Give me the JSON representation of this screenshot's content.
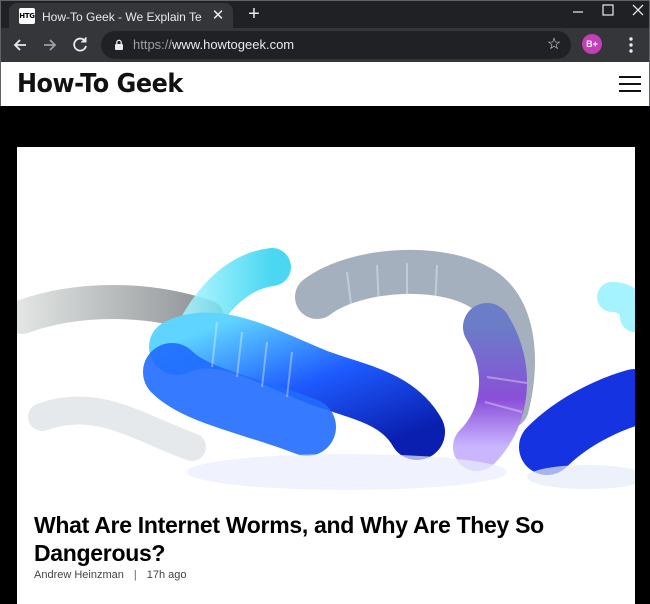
{
  "browser": {
    "tab": {
      "favicon_text": "HTG",
      "title": "How-To Geek - We Explain Techn",
      "close_glyph": "✕"
    },
    "new_tab_glyph": "+",
    "window_controls": {
      "minimize": "—",
      "maximize": "☐",
      "close": "✕"
    },
    "address_bar": {
      "scheme": "https://",
      "host": "www.howtogeek.com"
    },
    "bookmark_glyph": "☆",
    "profile_initials": "B+"
  },
  "site": {
    "logo_text": "How-To Geek"
  },
  "article": {
    "headline": "What Are Internet Worms, and Why Are They So Dangerous?",
    "author": "Andrew Heinzman",
    "separator": "|",
    "time_ago": "17h ago"
  },
  "colors": {
    "chrome_bg": "#202124",
    "toolbar_bg": "#35363a",
    "profile_accent": "#c23fb8",
    "page_bg": "#000000"
  },
  "icons": {
    "back": "arrow-left-icon",
    "forward": "arrow-right-icon",
    "reload": "reload-icon",
    "lock": "lock-icon",
    "star": "star-icon",
    "menu": "vertical-dots-icon",
    "site_menu": "hamburger-icon"
  }
}
